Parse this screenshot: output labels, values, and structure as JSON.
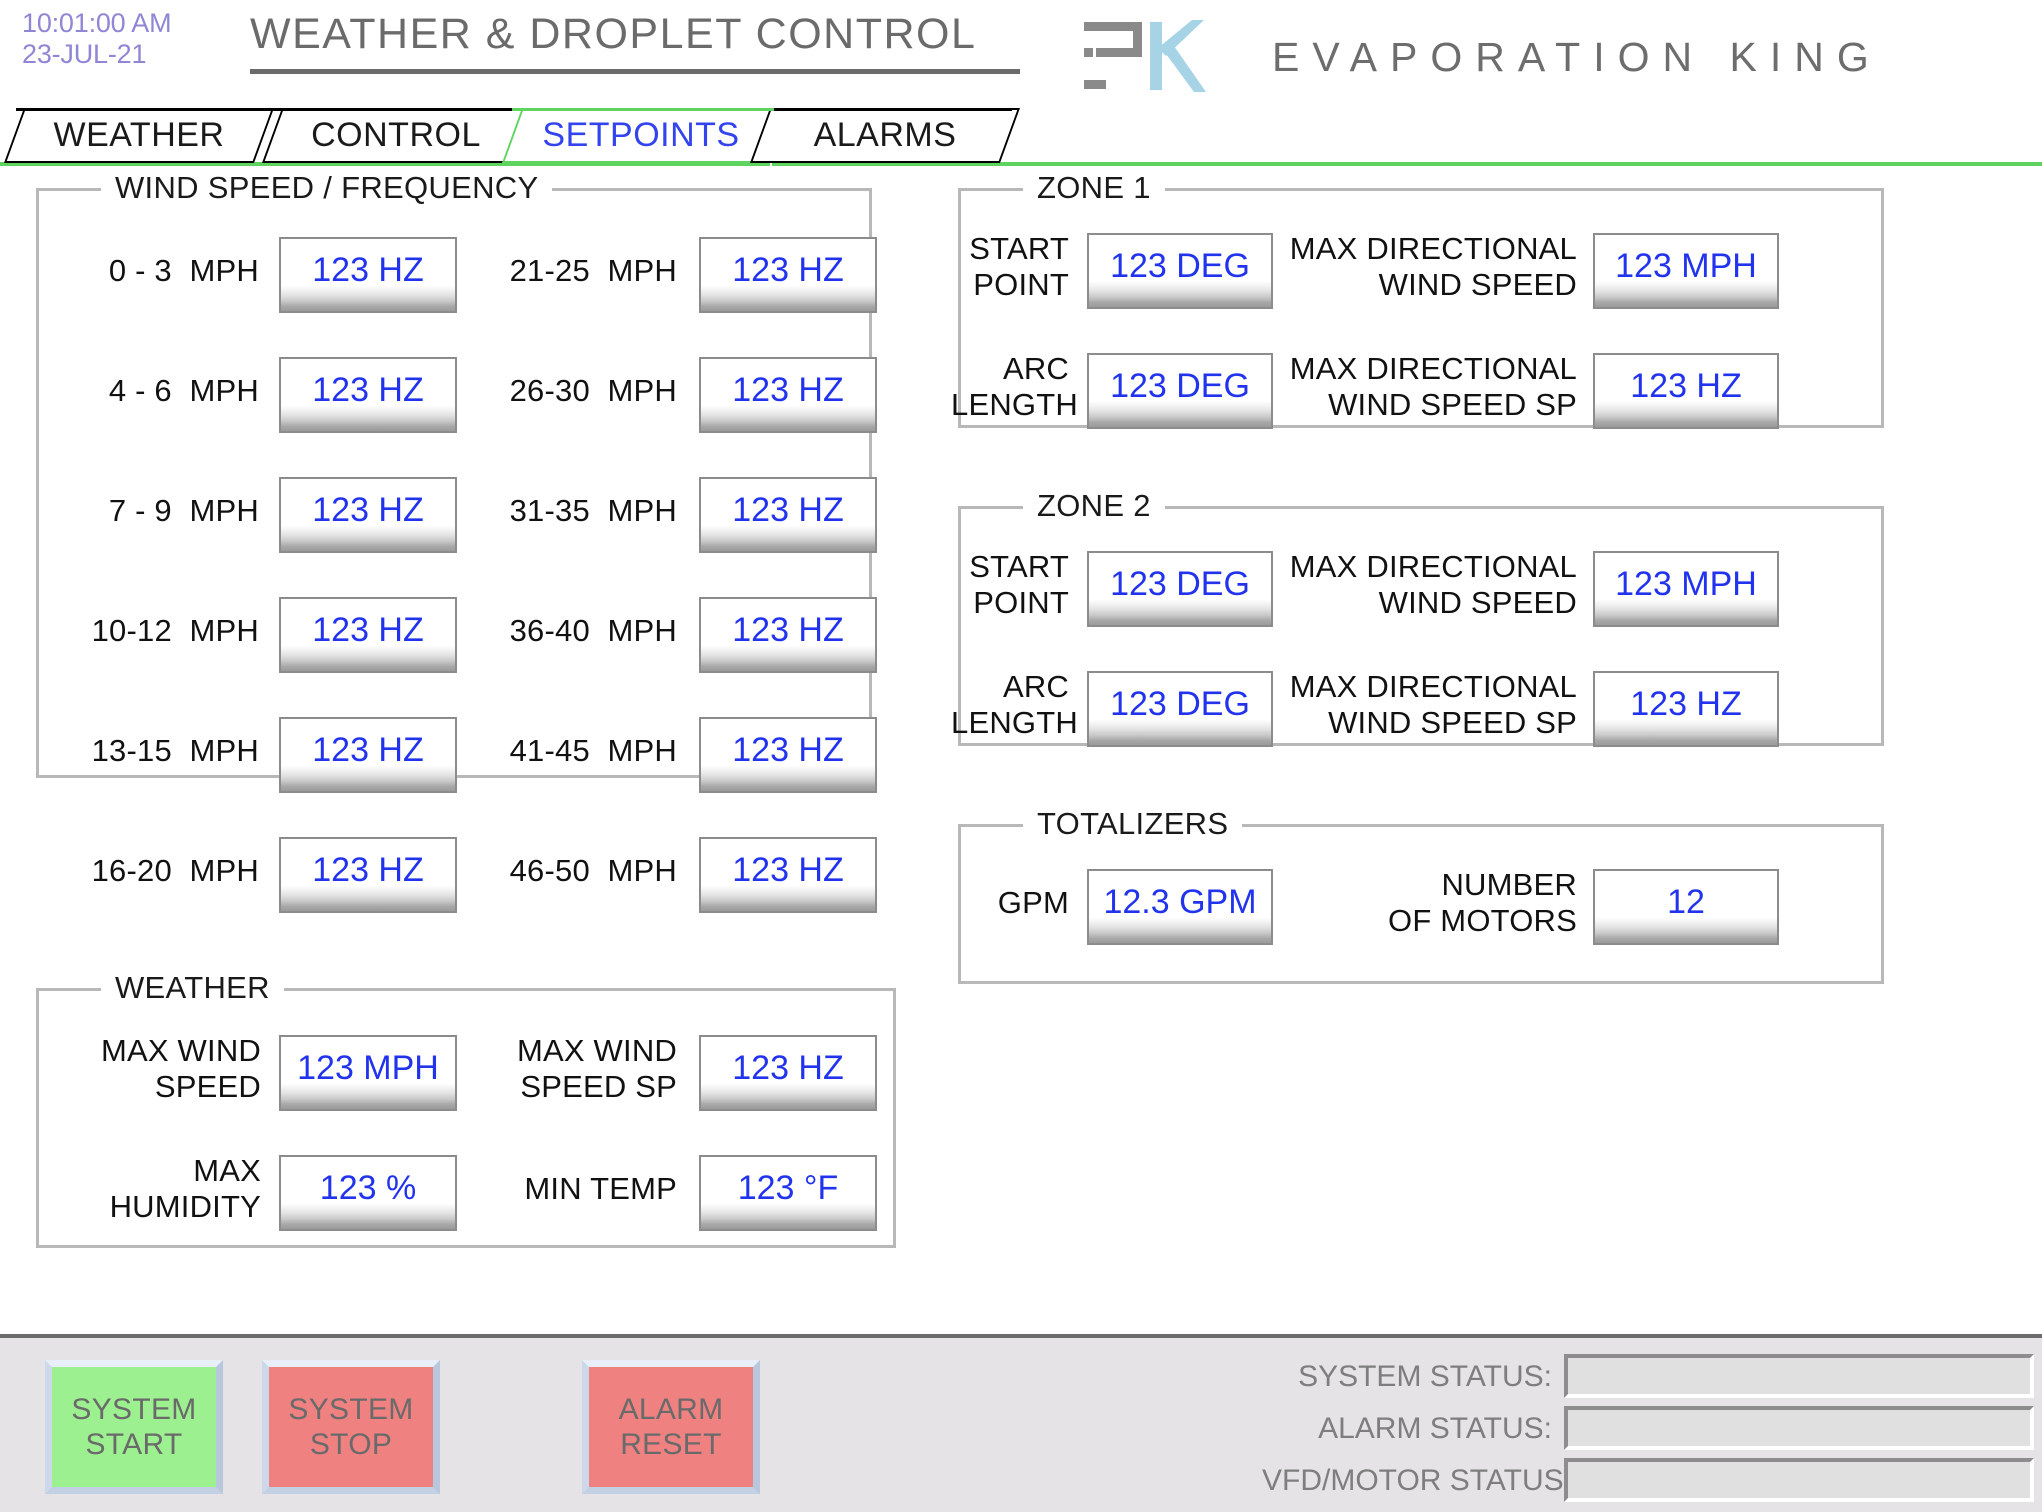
{
  "header": {
    "time": "10:01:00 AM",
    "date": "23-JUL-21",
    "title": "WEATHER & DROPLET CONTROL",
    "brand": "EVAPORATION KING",
    "logo_icon": "ek-monogram-icon"
  },
  "tabs": [
    {
      "label": "WEATHER",
      "active": false
    },
    {
      "label": "CONTROL",
      "active": false
    },
    {
      "label": "SETPOINTS",
      "active": true
    },
    {
      "label": "ALARMS",
      "active": false
    }
  ],
  "wind_speed_frequency": {
    "legend": "WIND SPEED / FREQUENCY",
    "col_left": [
      {
        "label": "0 - 3  MPH",
        "value": "123 HZ"
      },
      {
        "label": "4 - 6  MPH",
        "value": "123 HZ"
      },
      {
        "label": "7 - 9  MPH",
        "value": "123 HZ"
      },
      {
        "label": "10-12  MPH",
        "value": "123 HZ"
      },
      {
        "label": "13-15  MPH",
        "value": "123 HZ"
      },
      {
        "label": "16-20  MPH",
        "value": "123 HZ"
      }
    ],
    "col_right": [
      {
        "label": "21-25  MPH",
        "value": "123 HZ"
      },
      {
        "label": "26-30  MPH",
        "value": "123 HZ"
      },
      {
        "label": "31-35  MPH",
        "value": "123 HZ"
      },
      {
        "label": "36-40  MPH",
        "value": "123 HZ"
      },
      {
        "label": "41-45  MPH",
        "value": "123 HZ"
      },
      {
        "label": "46-50  MPH",
        "value": "123 HZ"
      }
    ]
  },
  "weather": {
    "legend": "WEATHER",
    "fields": [
      {
        "label": "MAX WIND\nSPEED",
        "value": "123 MPH"
      },
      {
        "label": "MAX WIND\nSPEED SP",
        "value": "123 HZ"
      },
      {
        "label": "MAX\nHUMIDITY",
        "value": "123 %"
      },
      {
        "label": "MIN TEMP",
        "value": "123 °F"
      }
    ]
  },
  "zone1": {
    "legend": "ZONE 1",
    "fields": [
      {
        "label": "START\nPOINT",
        "value": "123 DEG"
      },
      {
        "label": "MAX DIRECTIONAL\nWIND SPEED",
        "value": "123 MPH"
      },
      {
        "label": "ARC\nLENGTH",
        "value": "123 DEG"
      },
      {
        "label": "MAX DIRECTIONAL\nWIND SPEED SP",
        "value": "123 HZ"
      }
    ]
  },
  "zone2": {
    "legend": "ZONE 2",
    "fields": [
      {
        "label": "START\nPOINT",
        "value": "123 DEG"
      },
      {
        "label": "MAX DIRECTIONAL\nWIND SPEED",
        "value": "123 MPH"
      },
      {
        "label": "ARC\nLENGTH",
        "value": "123 DEG"
      },
      {
        "label": "MAX DIRECTIONAL\nWIND SPEED SP",
        "value": "123 HZ"
      }
    ]
  },
  "totalizers": {
    "legend": "TOTALIZERS",
    "fields": [
      {
        "label": "GPM",
        "value": "12.3 GPM"
      },
      {
        "label": "NUMBER\nOF MOTORS",
        "value": "12"
      }
    ]
  },
  "footer": {
    "buttons": [
      {
        "label": "SYSTEM\nSTART",
        "color": "#9cf08f"
      },
      {
        "label": "SYSTEM\nSTOP",
        "color": "#ef8181"
      },
      {
        "label": "ALARM\nRESET",
        "color": "#ef8181"
      }
    ],
    "status_rows": [
      {
        "label": "SYSTEM STATUS:",
        "value": ""
      },
      {
        "label": "ALARM STATUS:",
        "value": ""
      },
      {
        "label": "VFD/MOTOR STATUS:",
        "value": ""
      }
    ]
  },
  "colors": {
    "accent_green": "#5ed45e",
    "value_blue": "#2233ee",
    "clock_purple": "#8f86d6",
    "title_gray": "#6b6b6b",
    "logo_blue": "#a7d3e6",
    "start_green": "#9cf08f",
    "stop_red": "#ef8181"
  }
}
